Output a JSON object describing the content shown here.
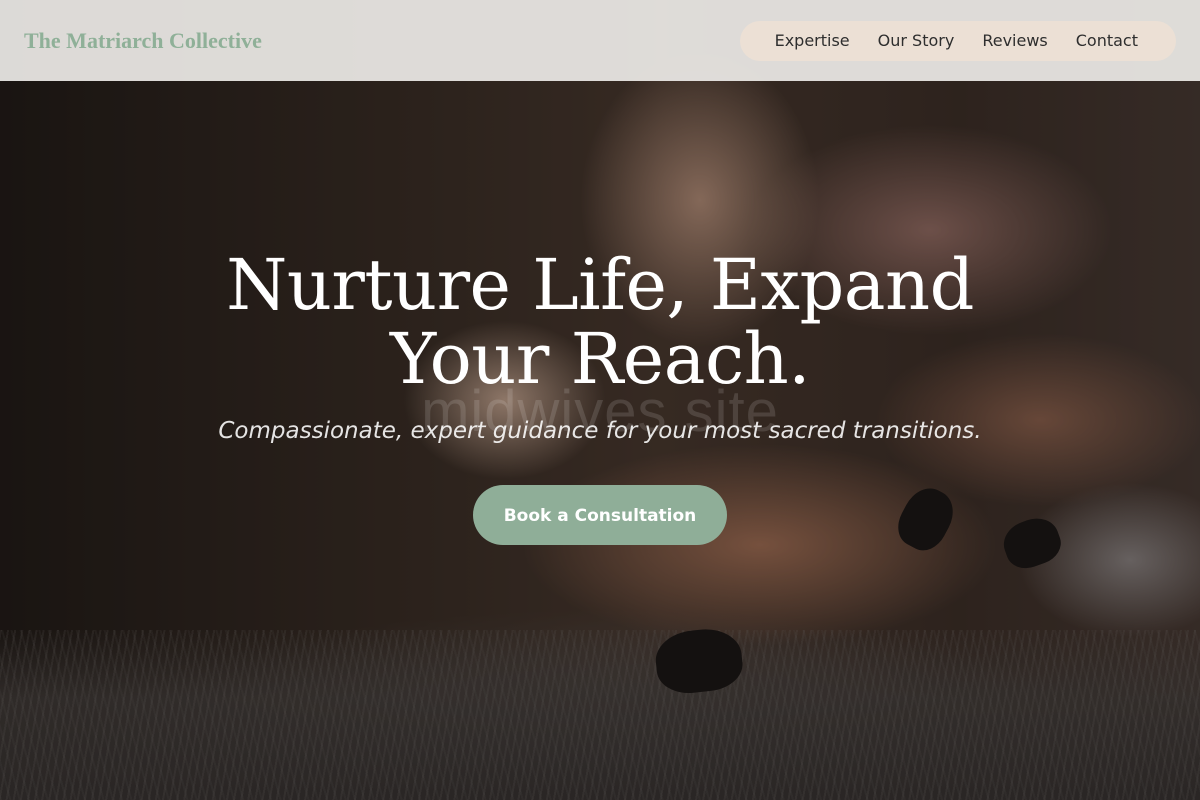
{
  "site": {
    "brand": "The Matriarch Collective"
  },
  "nav": {
    "items": [
      {
        "label": "Expertise"
      },
      {
        "label": "Our Story"
      },
      {
        "label": "Reviews"
      },
      {
        "label": "Contact"
      }
    ]
  },
  "hero": {
    "title": "Nurture Life, Expand Your Reach.",
    "subtitle": "Compassionate, expert guidance for your most sacred transitions.",
    "cta_label": "Book a Consultation",
    "watermark": "midwives site"
  },
  "colors": {
    "brand": "#8fb098",
    "cta_background": "#8fae98",
    "header_background": "#eceae6",
    "nav_pill": "#f0e2d4",
    "nail_polish": "#141212"
  }
}
